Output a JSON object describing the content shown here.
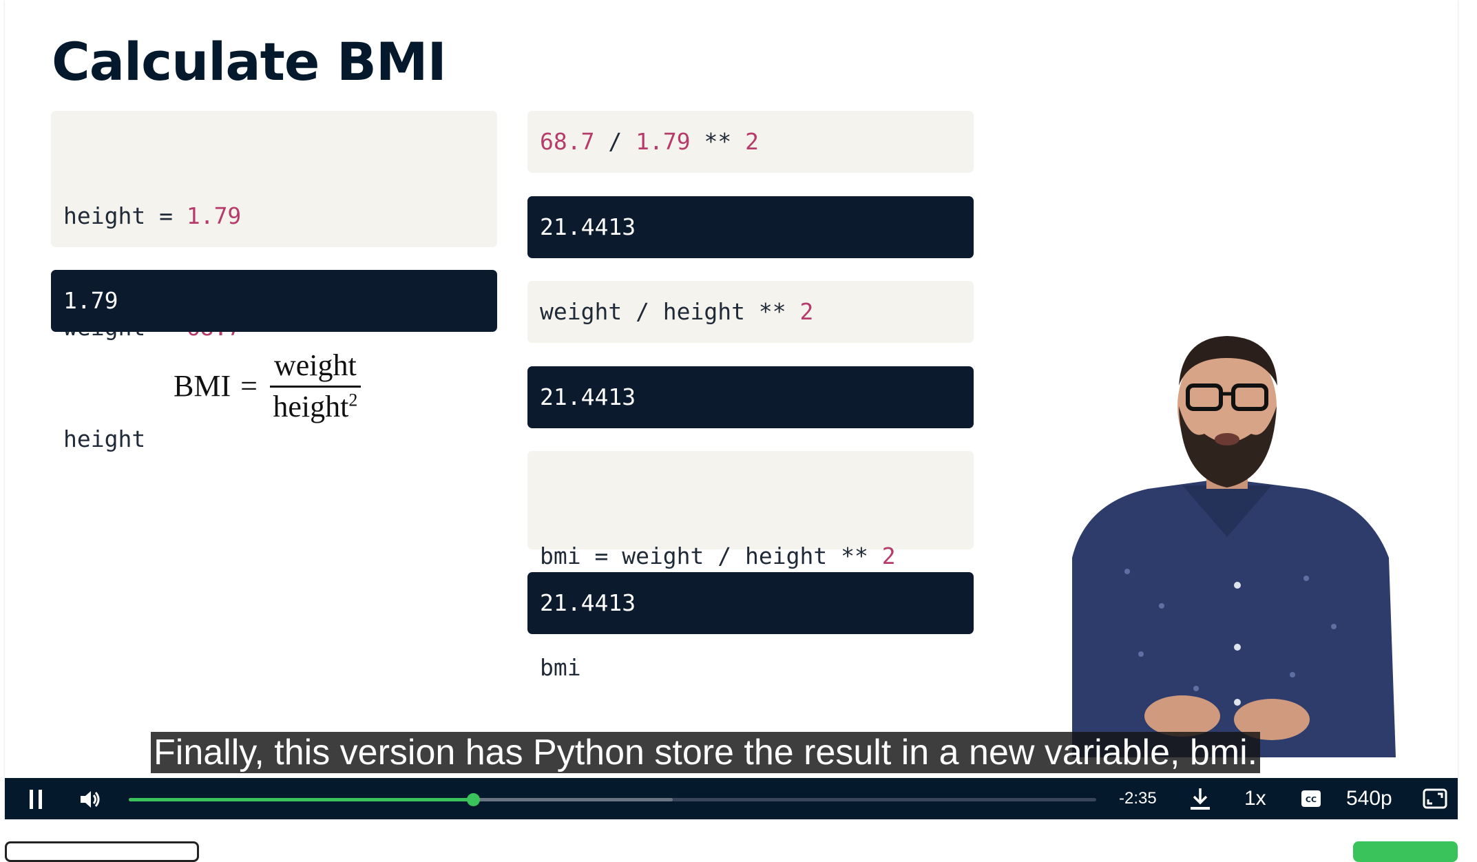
{
  "slide": {
    "title": "Calculate BMI",
    "left_column": {
      "code_lines": [
        {
          "name": "height",
          "op": " = ",
          "value": "1.79"
        },
        {
          "name": "weight",
          "op": " = ",
          "value": "68.7"
        },
        {
          "name": "height",
          "op": "",
          "value": ""
        }
      ],
      "output": "1.79"
    },
    "formula": {
      "lhs": "BMI",
      "equals": "=",
      "numerator": "weight",
      "denominator": "height",
      "exponent": "2"
    },
    "right_column": {
      "block1": {
        "a": "68.7",
        "op1": " / ",
        "b": "1.79",
        "op2": " ** ",
        "c": "2"
      },
      "output1": "21.4413",
      "block2": {
        "a": "weight / height ** ",
        "c": "2"
      },
      "output2": "21.4413",
      "block3": {
        "line1_text": "bmi = weight / height ** ",
        "line1_num": "2",
        "line2": "bmi"
      },
      "output3": "21.4413"
    }
  },
  "caption": "Finally, this version has Python store the result in a new variable, bmi.",
  "player": {
    "time_remaining": "-2:35",
    "speed": "1x",
    "quality": "540p",
    "progress_fraction": 0.356,
    "buffered_fraction": 0.562,
    "accent_color": "#3ac35a",
    "bar_color": "#05192d"
  }
}
